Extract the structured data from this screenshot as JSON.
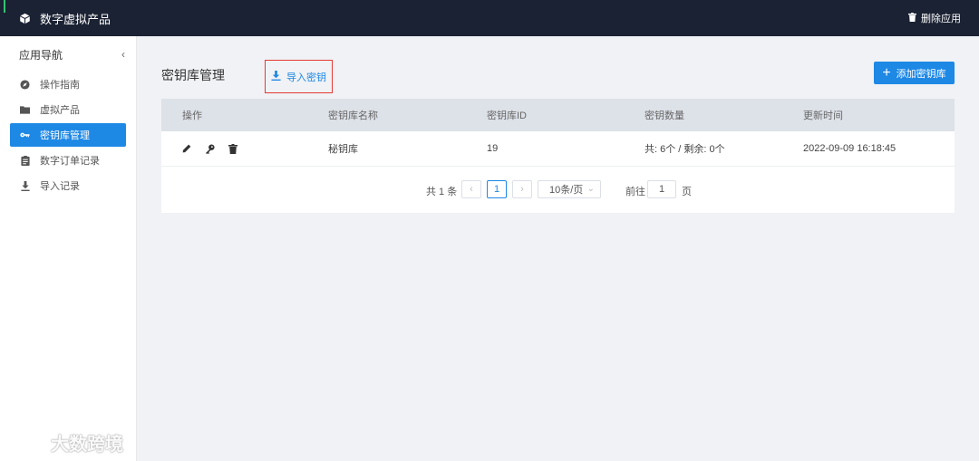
{
  "topbar": {
    "title": "数字虚拟产品",
    "delete_app_label": "删除应用",
    "logo_icon": "cube-icon",
    "delete_icon": "trash-icon"
  },
  "sidebar": {
    "header": "应用导航",
    "collapse_glyph": "‹",
    "items": [
      {
        "label": "操作指南",
        "icon": "compass-icon",
        "active": false
      },
      {
        "label": "虚拟产品",
        "icon": "folder-icon",
        "active": false
      },
      {
        "label": "密钥库管理",
        "icon": "key-icon",
        "active": true
      },
      {
        "label": "数字订单记录",
        "icon": "clipboard-icon",
        "active": false
      },
      {
        "label": "导入记录",
        "icon": "download-icon",
        "active": false
      }
    ]
  },
  "watermark": {
    "text": "大数跨境"
  },
  "page": {
    "title": "密钥库管理",
    "import_label": "导入密钥",
    "add_label": "添加密钥库",
    "add_glyph": "+"
  },
  "table": {
    "headers": [
      "操作",
      "密钥库名称",
      "密钥库ID",
      "密钥数量",
      "更新时间"
    ],
    "rows": [
      {
        "name": "秘钥库",
        "id": "19",
        "count": "共: 6个 / 剩余: 0个",
        "updated": "2022-09-09 16:18:45"
      }
    ]
  },
  "pager": {
    "total": "共 1 条",
    "prev_glyph": "‹",
    "current_page": "1",
    "next_glyph": "›",
    "page_size": "10条/页",
    "goto_label": "前往",
    "goto_value": "1",
    "page_unit": "页"
  },
  "colors": {
    "primary": "#1e88e5",
    "topbar": "#1b2233",
    "highlight_border": "#e53935"
  }
}
